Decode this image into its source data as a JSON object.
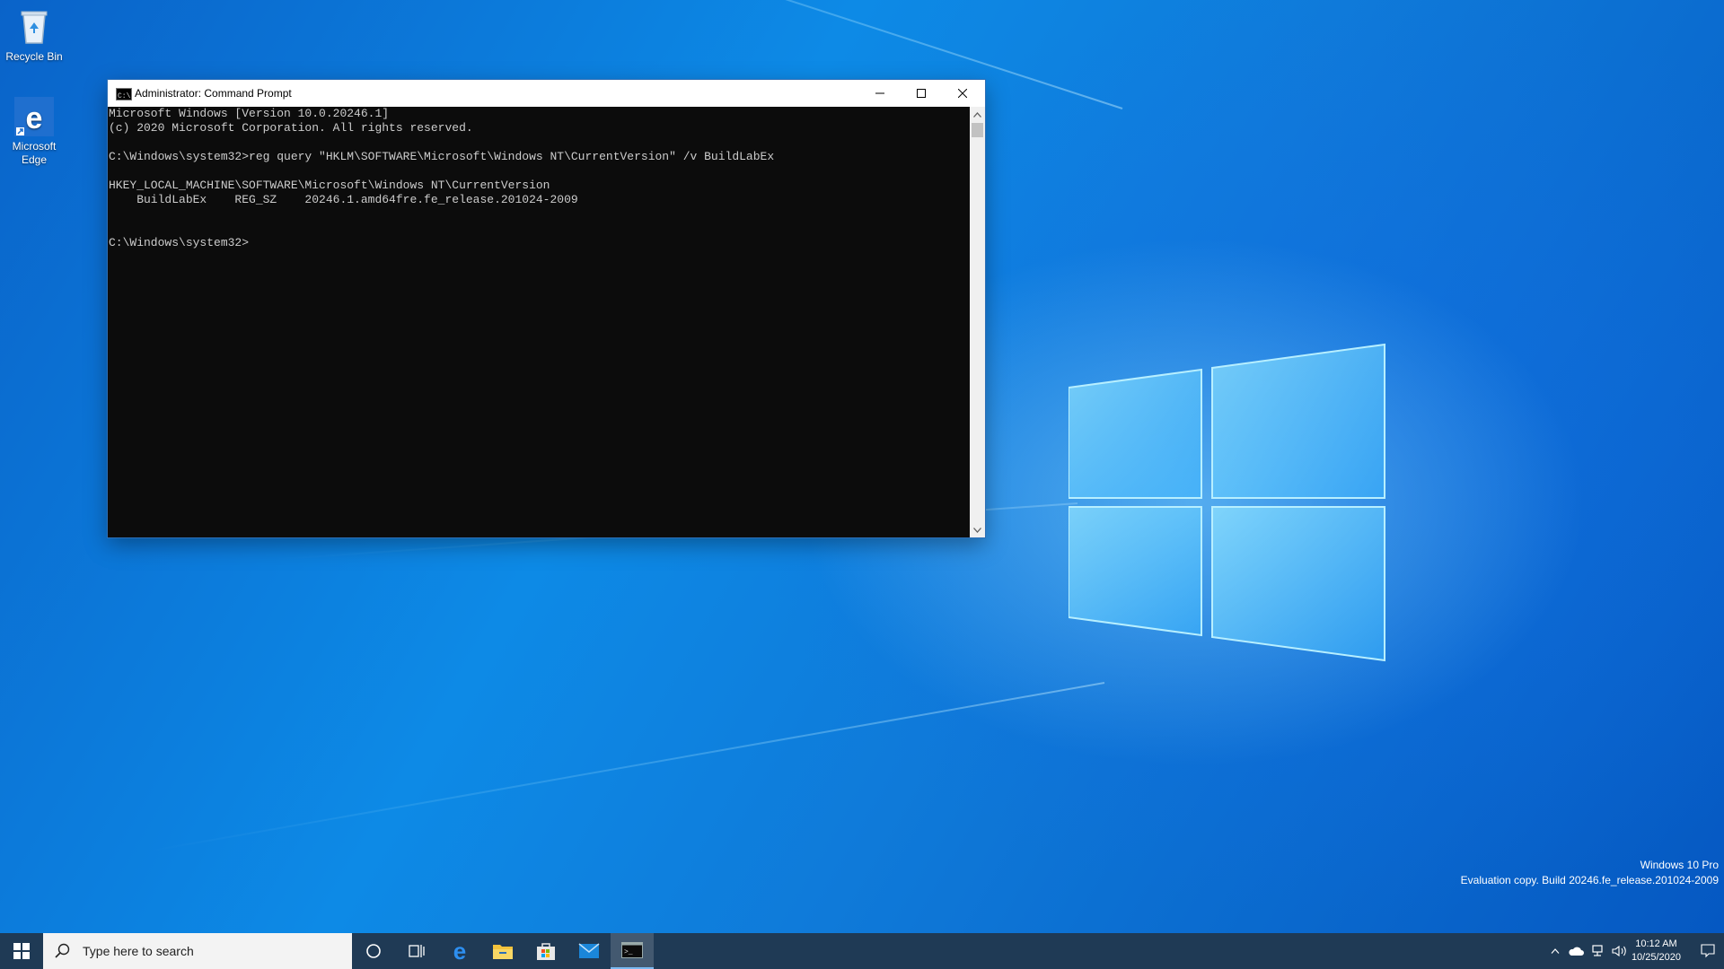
{
  "desktop": {
    "icons": [
      {
        "label": "Recycle Bin"
      },
      {
        "label": "Microsoft Edge"
      }
    ]
  },
  "cmd_window": {
    "title": "Administrator: Command Prompt",
    "console_text": "Microsoft Windows [Version 10.0.20246.1]\n(c) 2020 Microsoft Corporation. All rights reserved.\n\nC:\\Windows\\system32>reg query \"HKLM\\SOFTWARE\\Microsoft\\Windows NT\\CurrentVersion\" /v BuildLabEx\n\nHKEY_LOCAL_MACHINE\\SOFTWARE\\Microsoft\\Windows NT\\CurrentVersion\n    BuildLabEx    REG_SZ    20246.1.amd64fre.fe_release.201024-2009\n\n\nC:\\Windows\\system32>"
  },
  "watermark": {
    "line1": "Windows 10 Pro",
    "line2": "Evaluation copy. Build 20246.fe_release.201024-2009"
  },
  "taskbar": {
    "search_placeholder": "Type here to search",
    "pinned_icons": [
      "cortana-icon",
      "task-view-icon",
      "edge-icon",
      "file-explorer-icon",
      "store-icon",
      "mail-icon",
      "command-prompt-icon"
    ],
    "clock_time": "10:12 AM",
    "clock_date": "10/25/2020"
  },
  "colors": {
    "console_bg": "#0c0c0c",
    "console_fg": "#cccccc",
    "taskbar_bg": "#1f3a55",
    "desktop_blue": "#0d8ae6"
  }
}
